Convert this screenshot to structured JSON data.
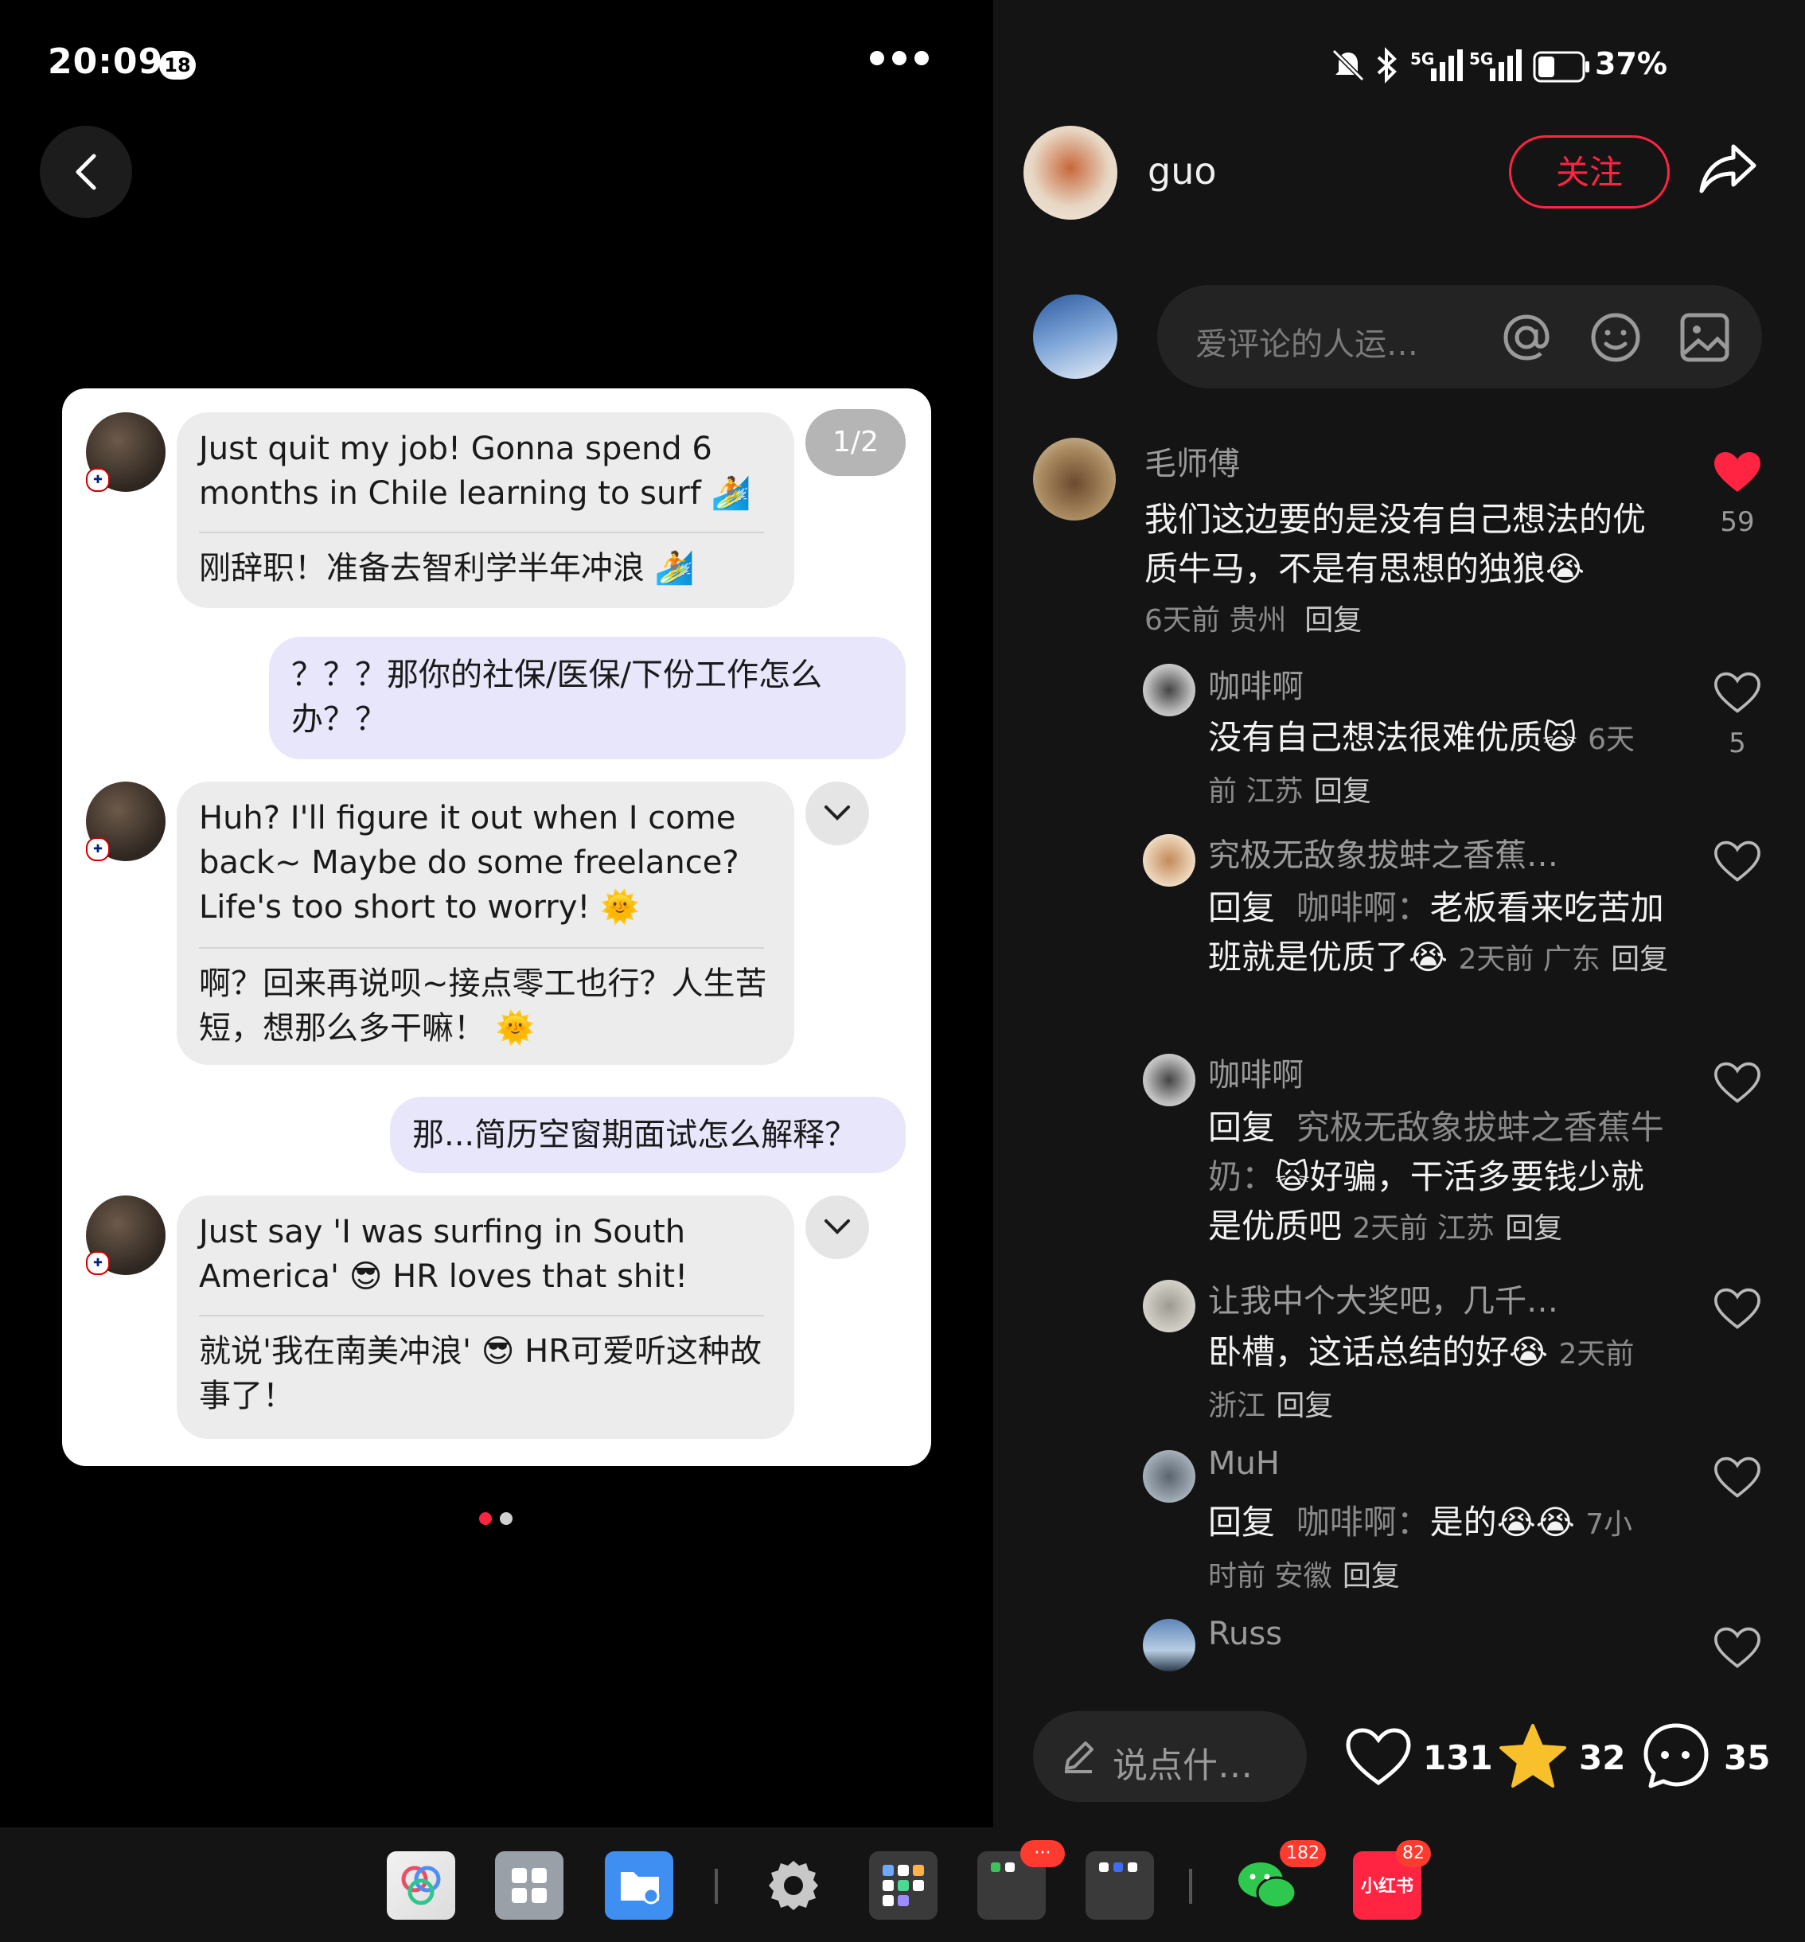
{
  "status": {
    "time": "20:09",
    "time_badge": "18",
    "battery": "37%",
    "signal1": "5G",
    "signal2": "5G"
  },
  "left": {
    "pager": "1/2",
    "messages": [
      {
        "side": "in",
        "en": "Just quit my job! Gonna spend 6 months in Chile learning to surf 🏄",
        "zh": "刚辞职！准备去智利学半年冲浪 🏄"
      },
      {
        "side": "out",
        "text": "？？？那你的社保/医保/下份工作怎么办？？"
      },
      {
        "side": "in",
        "en": "Huh? I'll figure it out when I come back~ Maybe do some freelance? Life's too short to worry! 🌞",
        "zh": "啊？回来再说呗~接点零工也行？人生苦短，想那么多干嘛！ 🌞"
      },
      {
        "side": "out",
        "text": "那...简历空窗期面试怎么解释？"
      },
      {
        "side": "in",
        "en": "Just say 'I was surfing in South America' 😎 HR loves that shit!",
        "zh": "就说'我在南美冲浪' 😎 HR可爱听这种故事了！"
      }
    ]
  },
  "right": {
    "author": "guo",
    "follow_label": "关注",
    "input_placeholder": "爱评论的人运…",
    "comments": [
      {
        "name": "毛师傅",
        "text": "我们这边要的是没有自己想法的优质牛马，不是有思想的独狼😭",
        "meta": "6天前 贵州",
        "reply": "回复",
        "likes": "59",
        "liked": true,
        "level": 0
      },
      {
        "name": "咖啡啊",
        "text": "没有自己想法很难优质🙀",
        "meta": "6天前 江苏",
        "reply": "回复",
        "likes": "5",
        "liked": false,
        "level": 1
      },
      {
        "name": "究极无敌象拔蚌之香蕉…",
        "reply_prefix": "回复",
        "reply_to": "咖啡啊：",
        "text": "老板看来吃苦加班就是优质了😭",
        "meta": "2天前 广东",
        "reply": "回复",
        "likes": "",
        "liked": false,
        "level": 1
      },
      {
        "name": "咖啡啊",
        "reply_prefix": "回复",
        "reply_to": "究极无敌象拔蚌之香蕉牛奶：",
        "text": "🙀好骗，干活多要钱少就是优质吧",
        "meta": "2天前 江苏",
        "reply": "回复",
        "likes": "",
        "liked": false,
        "level": 1
      },
      {
        "name": "让我中个大奖吧，几千…",
        "text": "卧槽，这话总结的好😭",
        "meta": "2天前 浙江",
        "reply": "回复",
        "likes": "",
        "liked": false,
        "level": 1
      },
      {
        "name": "MuH",
        "reply_prefix": "回复",
        "reply_to": "咖啡啊：",
        "text": "是的😭😭",
        "meta": "7小时前 安徽",
        "reply": "回复",
        "likes": "",
        "liked": false,
        "level": 1
      },
      {
        "name": "Russ",
        "text": "",
        "meta": "",
        "reply": "",
        "likes": "",
        "liked": false,
        "level": 1
      }
    ],
    "bottom": {
      "say_placeholder": "说点什…",
      "likes": "131",
      "stars": "32",
      "comments": "35"
    }
  },
  "dock": {
    "badges": {
      "folder": "···",
      "wechat": "182",
      "xiaohongshu": "82"
    },
    "xhs_label": "小红书"
  },
  "colors": {
    "accent": "#ff2442",
    "star": "#f8c12c",
    "purple_bubble": "#e8e6fb"
  }
}
